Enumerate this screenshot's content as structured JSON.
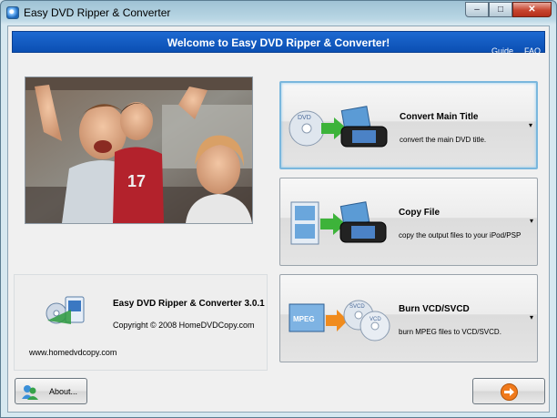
{
  "window": {
    "title": "Easy DVD Ripper & Converter",
    "controls": {
      "minimize": "–",
      "maximize": "□",
      "close": "✕"
    }
  },
  "banner": {
    "title": "Welcome to Easy DVD Ripper & Converter!",
    "links": {
      "guide": "Guide",
      "faq": "FAQ"
    }
  },
  "info": {
    "app_name": "Easy DVD Ripper & Converter 3.0.1",
    "copyright": "Copyright © 2008 HomeDVDCopy.com",
    "website": "www.homedvdcopy.com"
  },
  "actions": [
    {
      "title": "Convert Main Title",
      "description": "convert the main DVD title.",
      "arrow": "▾",
      "icon": "dvd-to-player-icon"
    },
    {
      "title": "Copy File",
      "description": "copy the output files to your iPod/PSP",
      "arrow": "▾",
      "icon": "film-to-player-icon"
    },
    {
      "title": "Burn VCD/SVCD",
      "description": "burn MPEG files to VCD/SVCD.",
      "arrow": "▾",
      "icon": "mpeg-to-disc-icon"
    }
  ],
  "footer": {
    "about_label": "About...",
    "next_icon": "orange-arrow-right-icon"
  },
  "colors": {
    "banner_blue": "#0b4fb3",
    "active_border": "#7ab7dd",
    "next_orange": "#f07a1c"
  }
}
